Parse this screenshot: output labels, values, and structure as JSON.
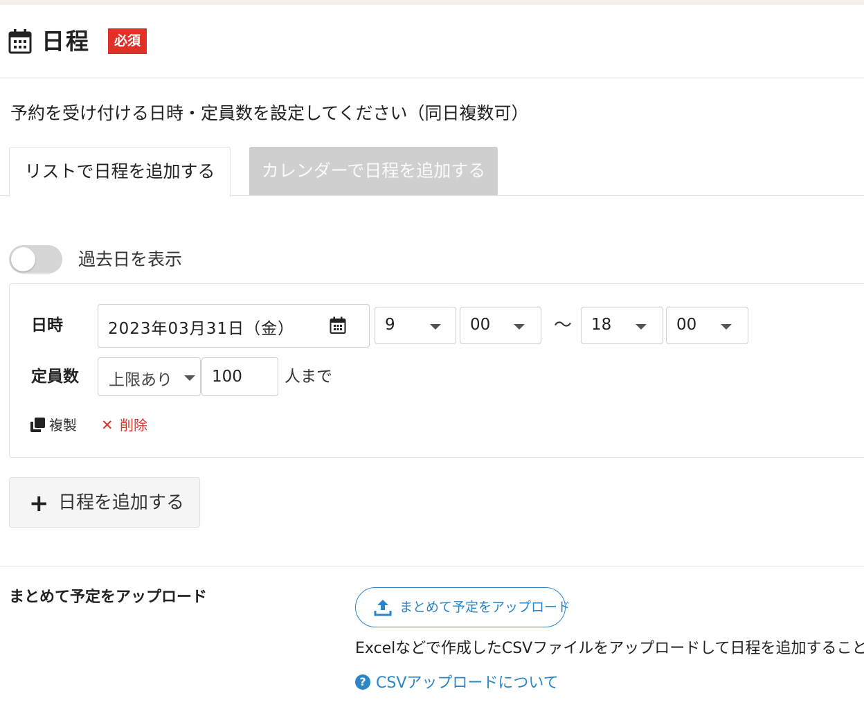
{
  "header": {
    "title": "日程",
    "required_badge": "必須",
    "icon": "calendar-icon"
  },
  "description": "予約を受け付ける日時・定員数を設定してください（同日複数可）",
  "tabs": [
    {
      "label": "リストで日程を追加する",
      "active": true
    },
    {
      "label": "カレンダーで日程を追加する",
      "active": false
    }
  ],
  "show_past": {
    "label": "過去日を表示",
    "enabled": false
  },
  "schedule": {
    "datetime_label": "日時",
    "date_value": "2023年03月31日（金）",
    "start_hour": "9",
    "start_minute": "00",
    "separator": "〜",
    "end_hour": "18",
    "end_minute": "00",
    "capacity_label": "定員数",
    "capacity_mode": "上限あり",
    "capacity_value": "100",
    "capacity_unit": "人まで",
    "copy_label": "複製",
    "delete_label": "削除"
  },
  "add_button": {
    "label": "日程を追加する"
  },
  "bulk_upload": {
    "section_label": "まとめて予定をアップロード",
    "button_label": "まとめて予定をアップロード",
    "note": "Excelなどで作成したCSVファイルをアップロードして日程を追加することができま",
    "help_link": "CSVアップロードについて"
  },
  "colors": {
    "required": "#e03028",
    "link": "#2a86c9",
    "delete": "#d9342b",
    "inactive_tab": "#cfcfcf"
  }
}
